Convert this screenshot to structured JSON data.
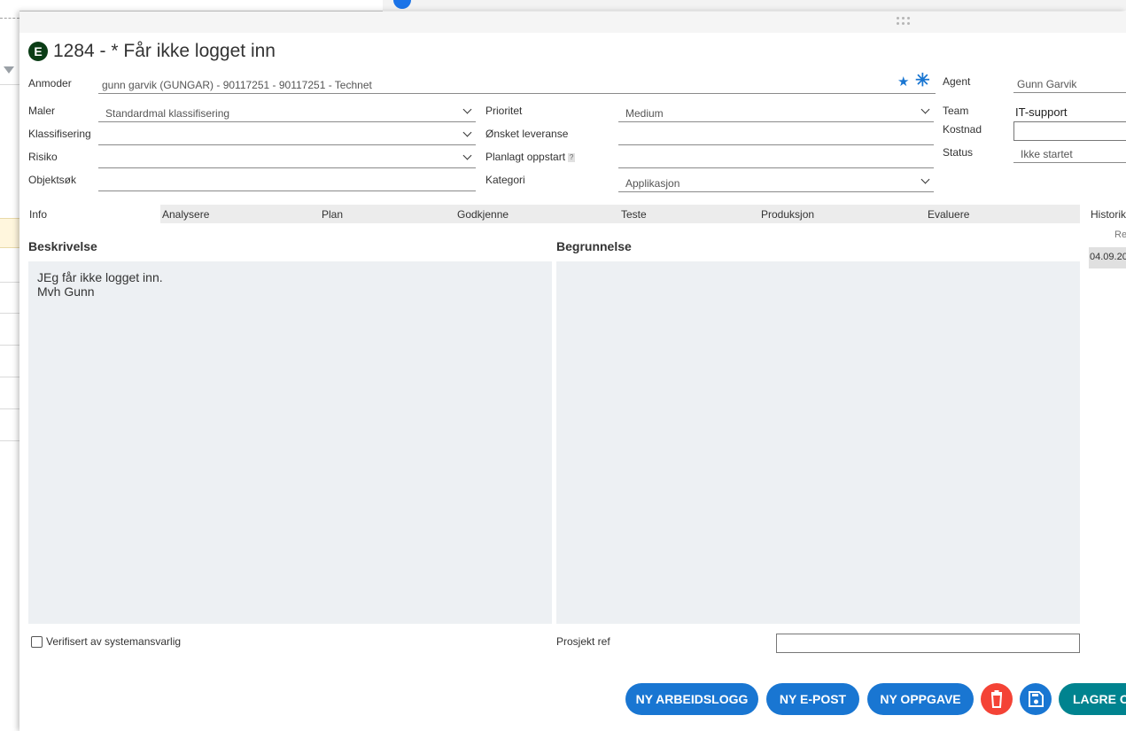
{
  "ticket": {
    "badge": "E",
    "title": "1284 - * Får ikke logget inn"
  },
  "form": {
    "anmoder": {
      "label": "Anmoder",
      "value": "gunn garvik (GUNGAR) - 90117251 - 90117251 - Technet"
    },
    "maler": {
      "label": "Maler",
      "value": "Standardmal klassifisering"
    },
    "klassifisering": {
      "label": "Klassifisering",
      "value": ""
    },
    "risiko": {
      "label": "Risiko",
      "value": ""
    },
    "objektsok": {
      "label": "Objektsøk",
      "value": ""
    },
    "prioritet": {
      "label": "Prioritet",
      "value": "Medium"
    },
    "onsket_leveranse": {
      "label": "Ønsket leveranse",
      "value": ""
    },
    "planlagt_oppstart": {
      "label": "Planlagt oppstart",
      "help": "?",
      "value": ""
    },
    "kategori": {
      "label": "Kategori",
      "value": "Applikasjon"
    },
    "agent": {
      "label": "Agent",
      "value": "Gunn Garvik"
    },
    "team": {
      "label": "Team",
      "value": "IT-support"
    },
    "kostnad": {
      "label": "Kostnad",
      "value": ""
    },
    "status": {
      "label": "Status",
      "value": "Ikke startet"
    }
  },
  "steps": {
    "info": "Info",
    "items": [
      "Analysere",
      "Plan",
      "Godkjenne",
      "Teste",
      "Produksjon",
      "Evaluere"
    ]
  },
  "beskrivelse": {
    "title": "Beskrivelse",
    "text": "JEg får ikke logget inn.\nMvh Gunn"
  },
  "begrunnelse": {
    "title": "Begrunnelse",
    "text": ""
  },
  "history": {
    "title": "Historik",
    "column": "Re",
    "row_date": "04.09.20"
  },
  "verify_label": "Verifisert av systemansvarlig",
  "prosjekt_ref_label": "Prosjekt ref",
  "buttons": {
    "new_worklog": "NY ARBEIDSLOGG",
    "new_email": "NY E-POST",
    "new_task": "NY OPPGAVE",
    "save_close": "LAGRE O"
  },
  "icons": [
    "star-icon",
    "asterisk-icon",
    "trash-icon",
    "floppy-disk-icon",
    "filter-icon",
    "drag-handle-icon"
  ],
  "colors": {
    "primary": "#1976d2",
    "danger": "#f44336",
    "teal": "#00838f",
    "badge": "#0b3d16",
    "field_bg": "#edf0f3"
  }
}
